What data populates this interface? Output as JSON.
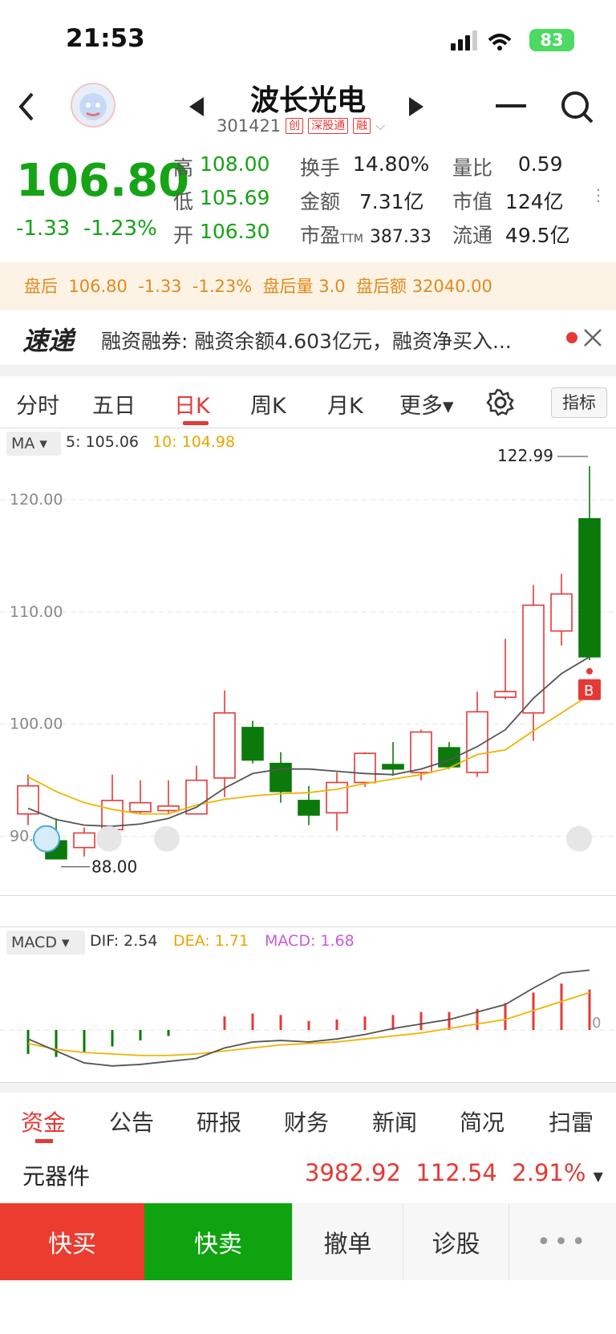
{
  "status": {
    "time": "21:53",
    "battery": "83"
  },
  "header": {
    "title": "波长光电",
    "code": "301421",
    "tags": [
      "创",
      "深股通",
      "融"
    ]
  },
  "quote": {
    "price": "106.80",
    "change": "-1.33",
    "change_pct": "-1.23%",
    "high_label": "高",
    "high": "108.00",
    "low_label": "低",
    "low": "105.69",
    "open_label": "开",
    "open": "106.30",
    "turnover_label": "换手",
    "turnover": "14.80%",
    "amount_label": "金额",
    "amount": "7.31亿",
    "pe_label": "市盈",
    "pe_sub": "TTM",
    "pe": "387.33",
    "volratio_label": "量比",
    "volratio": "0.59",
    "mcap_label": "市值",
    "mcap": "124亿",
    "float_label": "流通",
    "float": "49.5亿"
  },
  "afterhours": {
    "label": "盘后",
    "price": "106.80",
    "change": "-1.33",
    "pct": "-1.23%",
    "vol_label": "盘后量",
    "vol": "3.0",
    "amt_label": "盘后额",
    "amt": "32040.00"
  },
  "news": {
    "logo": "速递",
    "text": "融资融券: 融资余额4.603亿元，融资净买入..."
  },
  "tabs": [
    "分时",
    "五日",
    "日K",
    "周K",
    "月K",
    "更多▾"
  ],
  "indicator_button": "指标",
  "ma_legend": {
    "label": "MA",
    "ma5": "5: 105.06",
    "ma10": "10: 104.98"
  },
  "macd_legend": {
    "label": "MACD",
    "dif": "DIF: 2.54",
    "dea": "DEA: 1.71",
    "macd": "MACD: 1.68",
    "zero": "0"
  },
  "chart_data": {
    "type": "candlestick",
    "y_ticks": [
      "120.00",
      "110.00",
      "100.00",
      "90.00"
    ],
    "max_label": "122.99",
    "min_label": "88.00",
    "buy_marker": "B",
    "candles": [
      {
        "o": 92.0,
        "c": 94.5,
        "h": 95.5,
        "l": 91.0
      },
      {
        "o": 89.6,
        "c": 88.0,
        "h": 91.6,
        "l": 88.0
      },
      {
        "o": 89.0,
        "c": 90.3,
        "h": 90.8,
        "l": 88.2
      },
      {
        "o": 90.6,
        "c": 93.2,
        "h": 95.5,
        "l": 90.2
      },
      {
        "o": 92.2,
        "c": 93.0,
        "h": 95.0,
        "l": 92.0
      },
      {
        "o": 92.3,
        "c": 92.7,
        "h": 95.0,
        "l": 92.0
      },
      {
        "o": 92.0,
        "c": 95.0,
        "h": 96.3,
        "l": 92.0
      },
      {
        "o": 95.2,
        "c": 101.0,
        "h": 103.0,
        "l": 93.5
      },
      {
        "o": 99.7,
        "c": 96.8,
        "h": 100.3,
        "l": 96.5
      },
      {
        "o": 96.5,
        "c": 94.0,
        "h": 97.5,
        "l": 93.0
      },
      {
        "o": 93.2,
        "c": 91.9,
        "h": 94.5,
        "l": 91.0
      },
      {
        "o": 92.1,
        "c": 94.8,
        "h": 95.7,
        "l": 90.5
      },
      {
        "o": 94.8,
        "c": 97.4,
        "h": 97.5,
        "l": 94.4
      },
      {
        "o": 96.4,
        "c": 96.0,
        "h": 98.4,
        "l": 95.4
      },
      {
        "o": 95.7,
        "c": 99.3,
        "h": 99.5,
        "l": 95.0
      },
      {
        "o": 97.9,
        "c": 96.2,
        "h": 98.4,
        "l": 96.0
      },
      {
        "o": 95.7,
        "c": 101.1,
        "h": 102.9,
        "l": 95.3
      },
      {
        "o": 102.4,
        "c": 102.9,
        "h": 107.6,
        "l": 102.2
      },
      {
        "o": 101.0,
        "c": 110.6,
        "h": 112.4,
        "l": 98.5
      },
      {
        "o": 108.3,
        "c": 111.6,
        "h": 113.4,
        "l": 107.0
      },
      {
        "o": 118.3,
        "c": 106.0,
        "h": 122.99,
        "l": 105.7
      }
    ],
    "ma5": [
      92.5,
      91.5,
      91.0,
      90.9,
      91.1,
      91.6,
      92.6,
      94.3,
      95.6,
      96.0,
      96.0,
      95.8,
      95.6,
      95.5,
      96.0,
      96.8,
      98.0,
      99.5,
      102.3,
      104.5,
      106.0
    ],
    "ma10": [
      95.3,
      94.0,
      93.0,
      92.4,
      92.0,
      92.0,
      92.8,
      93.3,
      93.6,
      93.8,
      93.9,
      94.2,
      94.7,
      95.1,
      95.5,
      96.1,
      97.3,
      97.7,
      99.4,
      101.0,
      102.6
    ],
    "macd_hist": [
      -1.6,
      -1.8,
      -1.5,
      -1.1,
      -0.7,
      -0.4,
      0,
      0.9,
      1.1,
      1.0,
      0.6,
      0.7,
      0.9,
      1.0,
      1.2,
      1.2,
      1.4,
      1.8,
      2.5,
      3.1,
      2.7
    ],
    "dif": [
      -0.6,
      -1.4,
      -2.2,
      -2.4,
      -2.3,
      -2.1,
      -1.9,
      -1.2,
      -0.8,
      -0.7,
      -0.8,
      -0.6,
      -0.3,
      0.1,
      0.4,
      0.7,
      1.2,
      1.7,
      2.8,
      3.8,
      4.0
    ],
    "dea": [
      -0.9,
      -1.3,
      -1.5,
      -1.6,
      -1.7,
      -1.7,
      -1.6,
      -1.4,
      -1.2,
      -1.0,
      -0.9,
      -0.8,
      -0.6,
      -0.4,
      -0.2,
      0.1,
      0.4,
      0.7,
      1.3,
      1.9,
      2.5
    ]
  },
  "bottom_tabs": [
    "资金",
    "公告",
    "研报",
    "财务",
    "新闻",
    "简况",
    "扫雷"
  ],
  "sector": {
    "name": "元器件",
    "index": "3982.92",
    "change": "112.54",
    "pct": "2.91%"
  },
  "actions": {
    "buy": "快买",
    "sell": "快卖",
    "cancel": "撤单",
    "diagnose": "诊股",
    "more": "•••"
  },
  "colors": {
    "up": "#e53935",
    "down": "#0b7a0b",
    "ma5": "#555555",
    "ma10": "#f0b400"
  }
}
